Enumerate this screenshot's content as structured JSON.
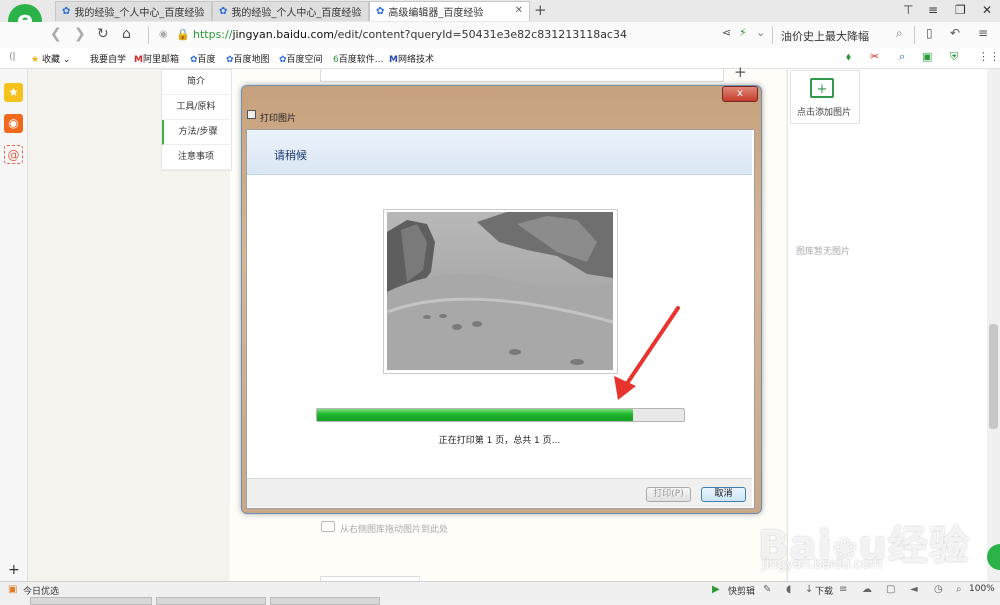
{
  "browser": {
    "tabs": [
      {
        "title": "我的经验_个人中心_百度经验"
      },
      {
        "title": "我的经验_个人中心_百度经验"
      },
      {
        "title": "高级编辑器_百度经验"
      }
    ],
    "url": {
      "prefix": "https://",
      "host": "jingyan.baidu.com",
      "path": "/edit/content?queryId=50431e3e82c831213118ac34"
    },
    "headline": "油价史上最大降幅"
  },
  "bookmarks": {
    "toggle": "收藏",
    "items": [
      "我要自学",
      "阿里邮箱",
      "百度",
      "百度地图",
      "百度空间",
      "百度软件...",
      "网络技术"
    ]
  },
  "outline": {
    "items": [
      "简介",
      "工具/原料",
      "方法/步骤",
      "注意事项"
    ],
    "current": 2
  },
  "right_panel": {
    "add_label": "点击添加图片",
    "empty_label": "图库暂无图片"
  },
  "editor": {
    "drag_hint": "从右侧图库拖动图片到此处"
  },
  "dialog": {
    "title": "打印图片",
    "close": "x",
    "heading": "请稍候",
    "progress": 0.86,
    "status": "正在打印第 1 页，总共 1 页...",
    "print_btn": "打印(P)",
    "cancel_btn": "取消",
    "progress_color": "#1db52c",
    "annotation_color": "#e8332f"
  },
  "statusbar": {
    "left": "今日优选",
    "items": [
      "快剪辑",
      "下载"
    ],
    "zoom": "100%"
  },
  "watermark": {
    "text": "Baidu经验",
    "sub": "jingyan.baidu.com"
  }
}
